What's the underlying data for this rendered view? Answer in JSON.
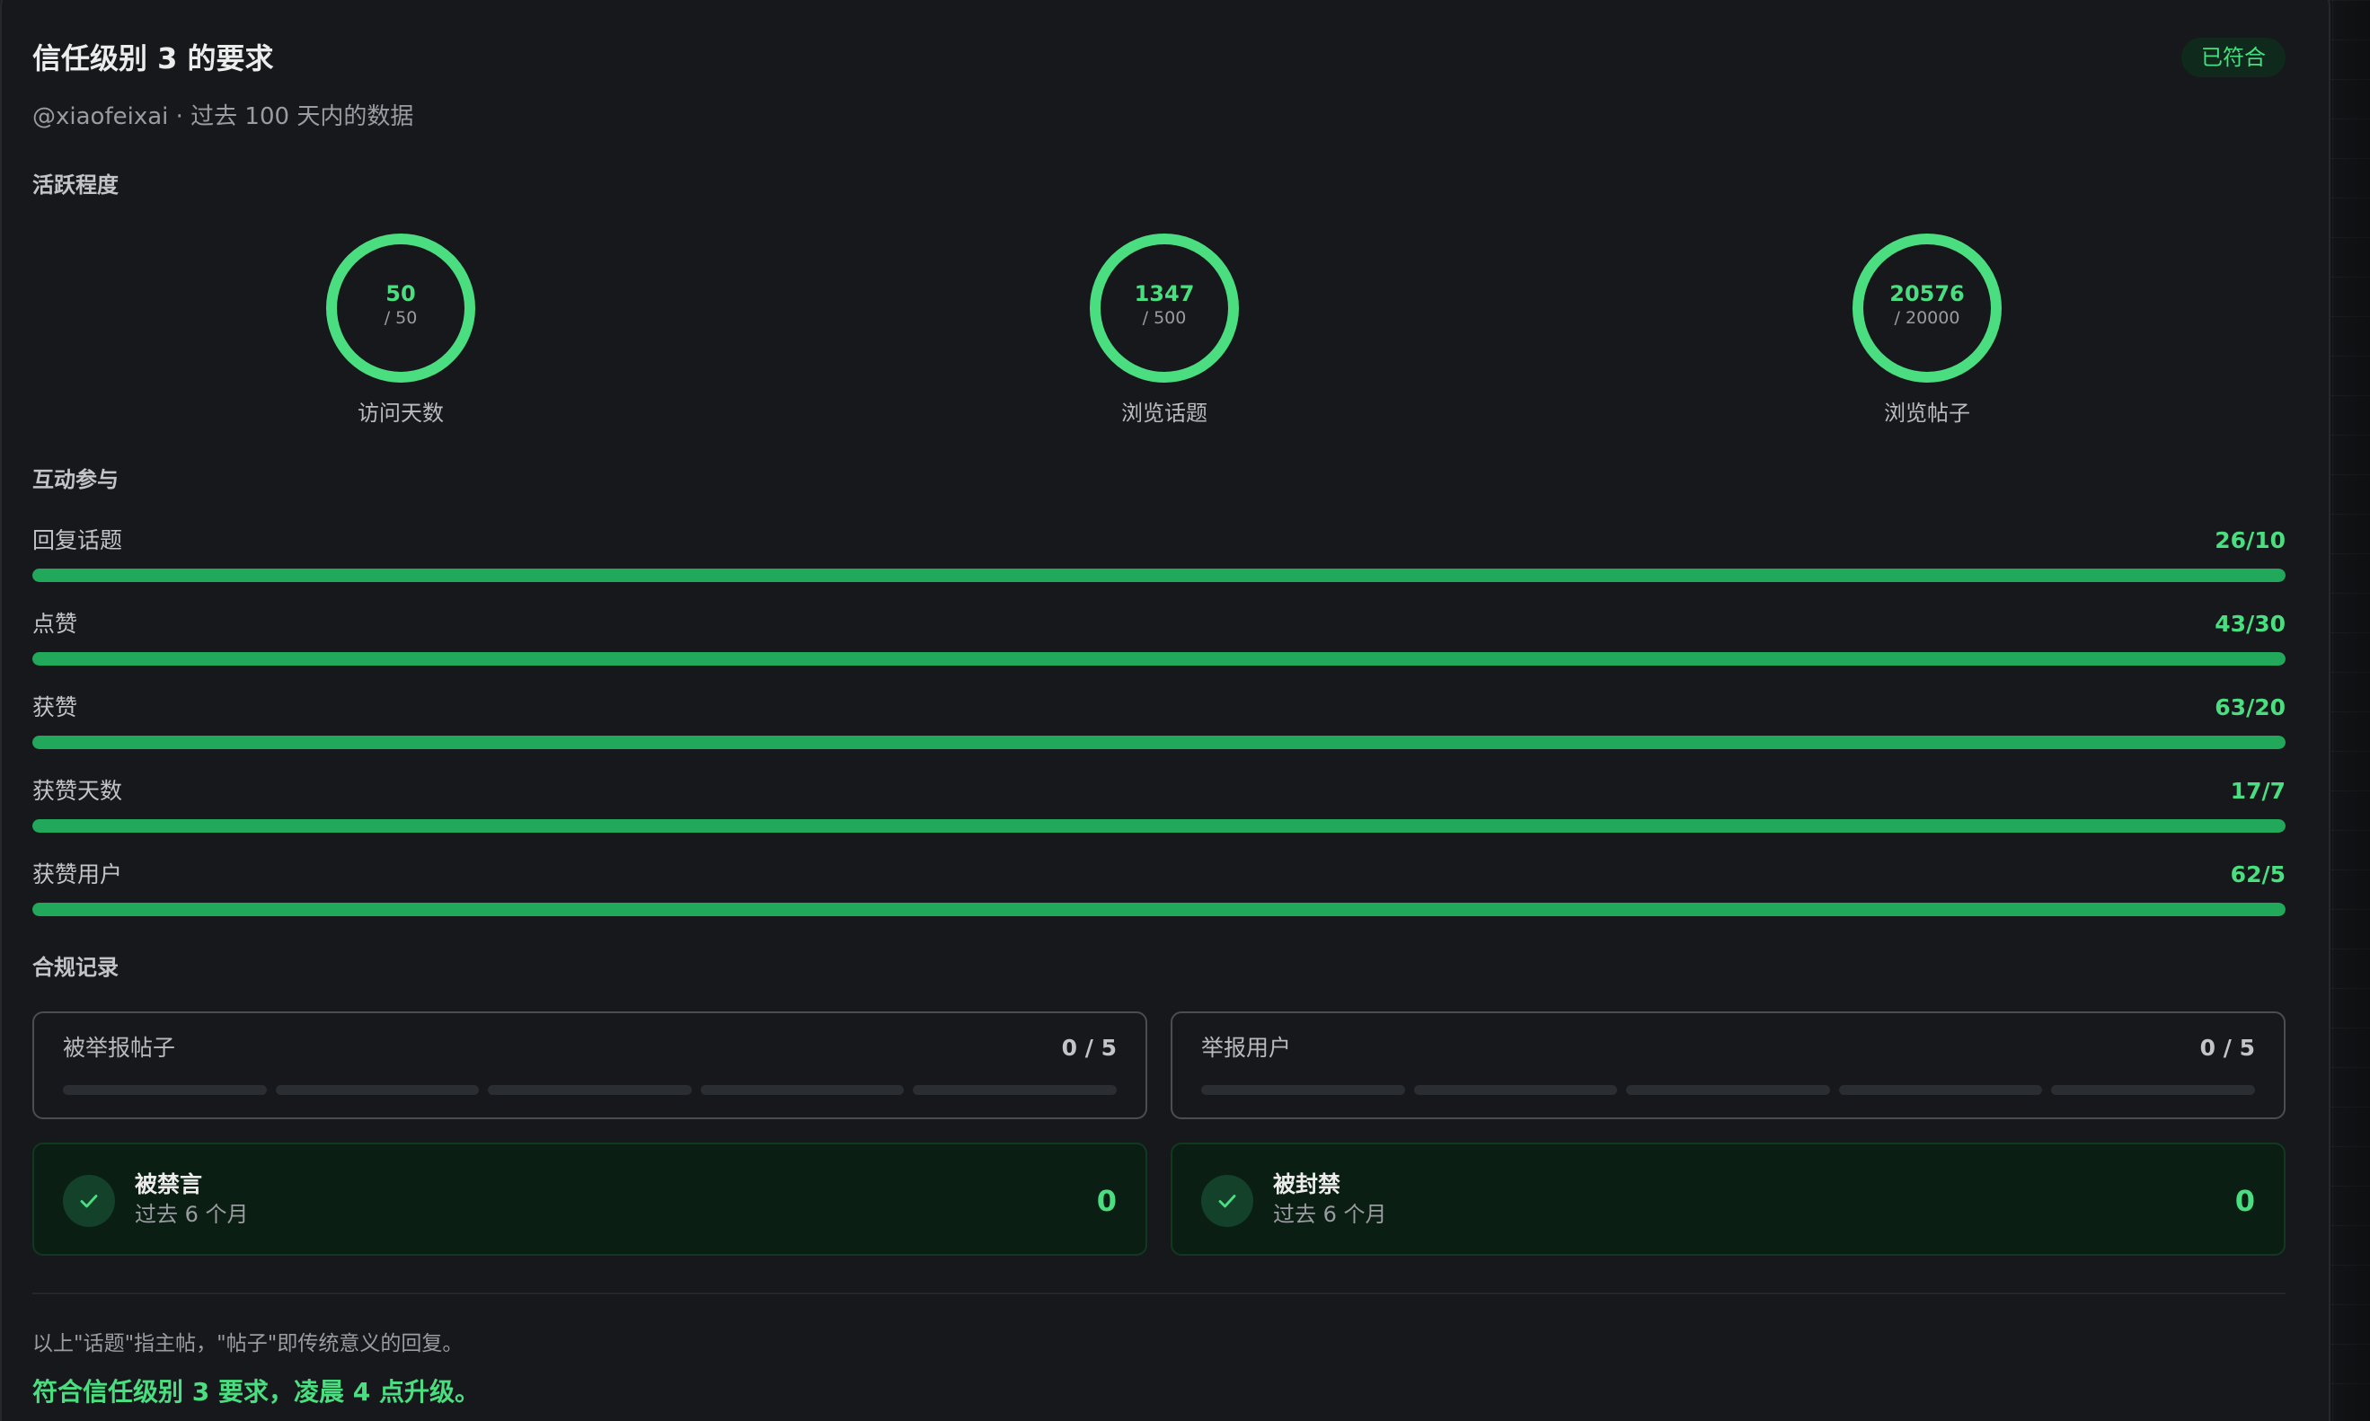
{
  "header": {
    "title": "信任级别 3 的要求",
    "badge": "已符合",
    "subtitle": "@xiaofeixai · 过去 100 天内的数据"
  },
  "activity": {
    "section": "活跃程度",
    "rings": [
      {
        "value": "50",
        "target": "/ 50",
        "label": "访问天数",
        "ratio": 1.0
      },
      {
        "value": "1347",
        "target": "/ 500",
        "label": "浏览话题",
        "ratio": 1.0
      },
      {
        "value": "20576",
        "target": "/ 20000",
        "label": "浏览帖子",
        "ratio": 1.0
      }
    ]
  },
  "interaction": {
    "section": "互动参与",
    "bars": [
      {
        "label": "回复话题",
        "value": "26/10",
        "ratio": 1.0
      },
      {
        "label": "点赞",
        "value": "43/30",
        "ratio": 1.0
      },
      {
        "label": "获赞",
        "value": "63/20",
        "ratio": 1.0
      },
      {
        "label": "获赞天数",
        "value": "17/7",
        "ratio": 1.0
      },
      {
        "label": "获赞用户",
        "value": "62/5",
        "ratio": 1.0
      }
    ]
  },
  "compliance": {
    "section": "合规记录",
    "reported_posts": {
      "label": "被举报帖子",
      "count": "0 / 5",
      "filled": 0,
      "segments": 5
    },
    "reported_users": {
      "label": "举报用户",
      "count": "0 / 5",
      "filled": 0,
      "segments": 5
    },
    "silenced": {
      "title": "被禁言",
      "sub": "过去 6 个月",
      "value": "0"
    },
    "suspended": {
      "title": "被封禁",
      "sub": "过去 6 个月",
      "value": "0"
    }
  },
  "footer": {
    "note": "以上\"话题\"指主帖，\"帖子\"即传统意义的回复。",
    "result": "符合信任级别 3 要求，凌晨 4 点升级。"
  },
  "colors": {
    "accent": "#4ade80",
    "bar_fill": "#22a85a",
    "track": "#2a2d31",
    "background": "#17181b"
  }
}
